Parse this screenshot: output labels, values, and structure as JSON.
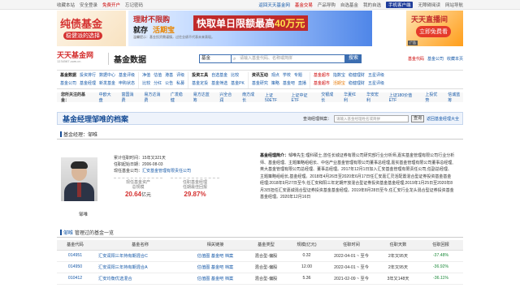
{
  "topbar": {
    "left": [
      "收藏本站",
      "安全登录",
      "免费开户",
      "忘记密码"
    ],
    "right": [
      "返回天天基金网",
      "基金交易",
      "产品导购",
      "自选基金",
      "我的自选",
      "手机客户端",
      "无障碍阅读",
      "网站导航"
    ],
    "badge": "手机客户端"
  },
  "banners": {
    "left_title": "纯债基金",
    "left_sub": "稳健派的选择",
    "mid_tag1": "理财不限购",
    "mid_tag2a": "就存",
    "mid_tag2b": "活期宝",
    "mid_main_a": "快取单日限额最高",
    "mid_main_b": "40万元",
    "mid_note": "温馨提示：基金投资需谨慎，过往业绩不代表未来表现。",
    "right_title": "天天直播间",
    "right_btn": "立即免费看",
    "right_ad": "广告"
  },
  "header": {
    "logo": "天天基金网",
    "logo_url": "1234567.com.cn",
    "site": "基金数据",
    "search_select": "基金",
    "search_placeholder": "请输入基金代码、名称或简拼",
    "search_btn": "搜索",
    "links": [
      "基金代码",
      "基金公司",
      "收藏本页"
    ]
  },
  "nav": [
    {
      "r1": [
        "基金数据",
        "投资排行",
        "数据中心",
        "基金评级"
      ],
      "r2": [
        "基金公司",
        "基金经理",
        "新发基金",
        "申购状态"
      ]
    },
    {
      "r1": [
        "净值",
        "估值",
        "港基",
        "评级"
      ],
      "r2": [
        "比较",
        "分红",
        "公告",
        "私募"
      ]
    },
    {
      "r1": [
        "投资工具",
        "自选基金",
        "比较"
      ],
      "r2": [
        "基金定投",
        "基金筛选",
        "基金PK"
      ]
    },
    {
      "r1": [
        "资讯互动",
        "观点",
        "学校",
        "专题"
      ],
      "r2": [
        "基金研究",
        "策略",
        "基金吧",
        "直播"
      ]
    },
    {
      "r1": [
        "基金超市",
        "指数宝",
        "稳健理财",
        "五星评级"
      ],
      "r2": [
        "基金超市",
        "活期宝",
        "稳健理财",
        "五星评级"
      ]
    }
  ],
  "focus": {
    "label": "您所关注的基金：",
    "items": [
      "中欧大盘",
      "富国消费",
      "易方达消费",
      "广发稳健",
      "易方达蓝筹",
      "兴全合润",
      "南方成长",
      "上证50ETF",
      "上证中证ETF",
      "交银成长",
      "华夏红利",
      "华安宏利",
      "上证180价值ETF",
      "上投优势",
      "信诚蓝筹"
    ]
  },
  "page": {
    "title": "基金经理邹唯的档案",
    "search_label": "查询经理档案：",
    "search_placeholder": "请输入基金经理姓名或简拼",
    "search_btn": "查询",
    "back_link": "返回基金经理大全"
  },
  "section1": "基金经理：邹唯",
  "manager": {
    "name": "邹唯",
    "tenure_label": "累计任职时间：",
    "tenure": "15年又321天",
    "start_label": "任职起始日期：",
    "start": "2006-08-03",
    "company_label": "现任基金公司：",
    "company": "汇安基金管理有限责任公司",
    "assets_label1": "现任基金资产",
    "assets_label2": "总规模",
    "assets_val": "20.64",
    "assets_unit": "亿元",
    "return_label1": "任职基金经理",
    "return_label2": "任期最佳回报",
    "return_val": "29.87%",
    "bio_title": "基金经理简介：",
    "bio": "邹唯先生:理科硕士,曾任长城证券有限公司研究部行业分析师,嘉实基金管理有限公司行业分析师、基金经理、主题策略组组长、中信产业基金管理有限公司董事总经理,嘉实基金管理有限公司董事总经理,英大基金管理有限公司总经理、董事总经理。2017年12月1日加入汇安基金管理有限责任公司,任副总经理、主题策略组组长,基金经理。2018年4月26日至2020年6月17日任汇安嘉汇灵活配置混合型证券投资基金基金经理;2018年9月27日至今,任汇安和阳三年定期开放混合型证券投资基金基金经理;2019年1月25日至2020年8月3日担任汇安嘉诚混合型证券投资基金基金经理。2019年8月28日至今,任汇安行业龙头混合型证券投资基金基金经理。2020年12月16日"
  },
  "section2": {
    "name": "邹唯",
    "rest": "管理过的基金一览"
  },
  "table": {
    "headers": [
      "基金代码",
      "基金名称",
      "相关链接",
      "基金类型",
      "规模(亿元)",
      "任职时间",
      "任职天数",
      "任职回报"
    ],
    "rows": [
      {
        "code": "014951",
        "name": "汇安润阳三年持有期混合C",
        "links": [
          "估值图",
          "基金吧",
          "档案"
        ],
        "type": "混合型-偏股",
        "size": "0.32",
        "period": "2022-04-01 ~ 至今",
        "days": "2年又95天",
        "ret": "-37.48%"
      },
      {
        "code": "014950",
        "name": "汇安润阳三年持有期混合A",
        "links": [
          "估值图",
          "基金吧",
          "档案"
        ],
        "type": "混合型-偏股",
        "size": "12.00",
        "period": "2022-04-01 ~ 至今",
        "days": "2年又95天",
        "ret": "-36.92%"
      },
      {
        "code": "010412",
        "name": "汇安均衡优选混合",
        "links": [
          "估值图",
          "基金吧",
          "档案"
        ],
        "type": "混合型-偏股",
        "size": "5.36",
        "period": "2021-02-09 ~ 至今",
        "days": "3年又148天",
        "ret": "-36.11%"
      }
    ]
  }
}
